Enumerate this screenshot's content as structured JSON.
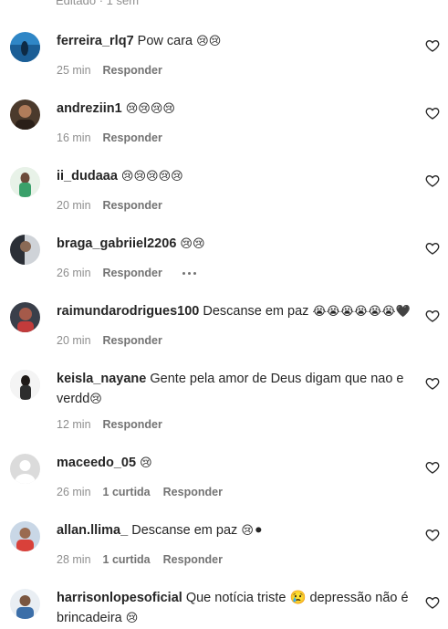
{
  "top_meta": "Editado · 1 sem",
  "comments": [
    {
      "user": "ferreira_rlq7",
      "text": "Pow cara",
      "emoji": "😢😢",
      "time": "25 min",
      "likes": "",
      "reply": "Responder"
    },
    {
      "user": "andreziin1",
      "text": "",
      "emoji": "😢😢😢😢",
      "time": "16 min",
      "likes": "",
      "reply": "Responder"
    },
    {
      "user": "ii_dudaaa",
      "text": "",
      "emoji": "😢😢😢😢😢",
      "time": "20 min",
      "likes": "",
      "reply": "Responder"
    },
    {
      "user": "braga_gabriiel2206",
      "text": "",
      "emoji": "😢😢",
      "time": "26 min",
      "likes": "",
      "reply": "Responder"
    },
    {
      "user": "raimundarodrigues100",
      "text": "Descanse em paz",
      "emoji": "😭😭😭😭😭😭🖤",
      "time": "20 min",
      "likes": "",
      "reply": "Responder"
    },
    {
      "user": "keisla_nayane",
      "text": "Gente pela amor de Deus digam que nao e verdd",
      "emoji": "😢",
      "time": "12 min",
      "likes": "",
      "reply": "Responder"
    },
    {
      "user": "maceedo_05",
      "text": "",
      "emoji": "😢",
      "time": "26 min",
      "likes": "1 curtida",
      "reply": "Responder"
    },
    {
      "user": "allan.llima_",
      "text": "Descanse em paz",
      "emoji": "😢⚫",
      "time": "28 min",
      "likes": "1 curtida",
      "reply": "Responder"
    },
    {
      "user": "harrisonlopesoficial",
      "text": "Que notícia triste 😢 depressão não é brincadeira",
      "emoji": "😢",
      "time": "",
      "likes": "",
      "reply": ""
    }
  ],
  "icons": {
    "like": "heart-outline-icon",
    "more": "more-horizontal-icon"
  },
  "colors": {
    "text": "#262626",
    "secondary": "#8e8e8e",
    "background": "#ffffff"
  }
}
